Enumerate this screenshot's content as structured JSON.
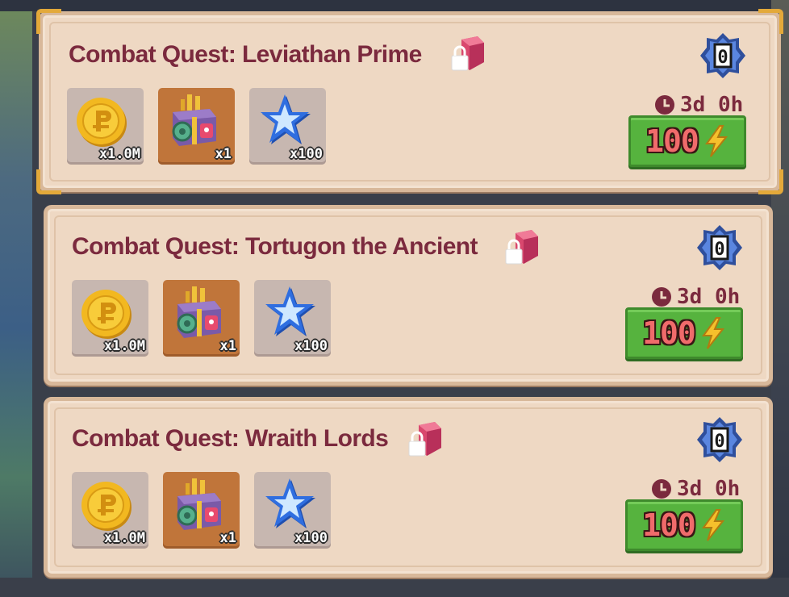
{
  "quests": [
    {
      "title": "Combat Quest: Leviathan Prime",
      "lock_icon": "locked-chest-icon",
      "badge_value": "0",
      "timer": "3d 0h",
      "cost": "100",
      "cost_icon": "lightning-bolt-icon",
      "rewards": [
        {
          "icon": "gold-coin-icon",
          "qty": "x1.0M"
        },
        {
          "icon": "treasure-chest-icon",
          "qty": "x1"
        },
        {
          "icon": "blue-star-icon",
          "qty": "x100"
        }
      ]
    },
    {
      "title": "Combat Quest: Tortugon the Ancient",
      "lock_icon": "locked-chest-icon",
      "badge_value": "0",
      "timer": "3d 0h",
      "cost": "100",
      "cost_icon": "lightning-bolt-icon",
      "rewards": [
        {
          "icon": "gold-coin-icon",
          "qty": "x1.0M"
        },
        {
          "icon": "treasure-chest-icon",
          "qty": "x1"
        },
        {
          "icon": "blue-star-icon",
          "qty": "x100"
        }
      ]
    },
    {
      "title": "Combat Quest: Wraith Lords",
      "lock_icon": "locked-chest-icon",
      "badge_value": "0",
      "timer": "3d 0h",
      "cost": "100",
      "cost_icon": "lightning-bolt-icon",
      "rewards": [
        {
          "icon": "gold-coin-icon",
          "qty": "x1.0M"
        },
        {
          "icon": "treasure-chest-icon",
          "qty": "x1"
        },
        {
          "icon": "blue-star-icon",
          "qty": "x100"
        }
      ]
    }
  ],
  "colors": {
    "card_bg": "#eed8c3",
    "title": "#7b2a3e",
    "button_green": "#56b33e",
    "cost_text": "#f06b6b",
    "selected_corner": "#e3a93a"
  }
}
